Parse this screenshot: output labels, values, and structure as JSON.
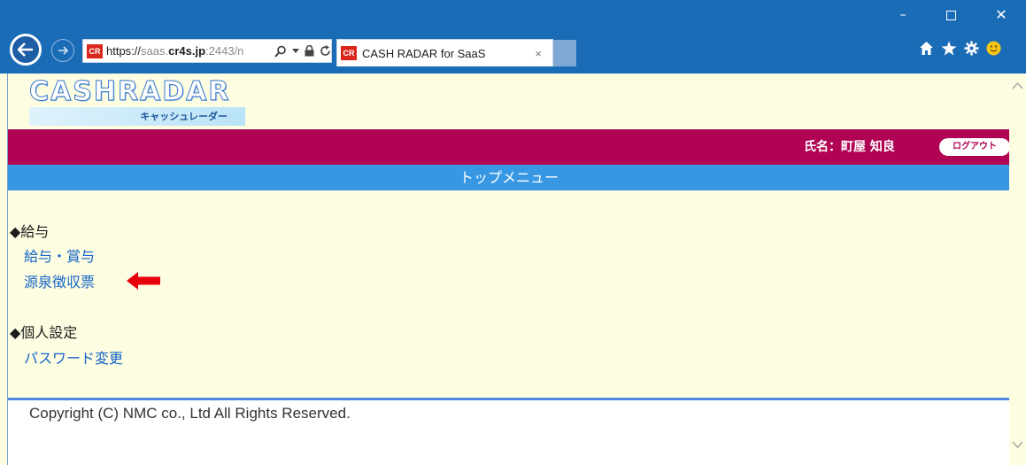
{
  "browser": {
    "url_host": "https://",
    "url_domain": "saas.",
    "url_bold": "cr4s.jp",
    "url_rest": ":2443/n",
    "tab_favicon": "CR",
    "tab_title": "CASH RADAR for SaaS",
    "tab_close": "×",
    "window_minimize": "–",
    "window_close": "✕"
  },
  "page": {
    "logo_text": "CASHRADAR",
    "logo_sub": "キャッシュレーダー",
    "user_label": "氏名：町屋 知良",
    "logout_label": "ログアウト",
    "menu_title": "トップメニュー",
    "sections": [
      {
        "heading": "◆給与",
        "links": [
          "給与・賞与",
          "源泉徴収票"
        ]
      },
      {
        "heading": "◆個人設定",
        "links": [
          "パスワード変更"
        ]
      }
    ],
    "copyright": "Copyright (C) NMC co., Ltd All Rights Reserved."
  },
  "colors": {
    "titlebar": "#1b6cb7",
    "page_bg": "#fdfde2",
    "userbar": "#b00353",
    "menubar": "#3797e3",
    "link": "#1565c8",
    "arrow": "#e8000b"
  },
  "icons": [
    "back-arrow-icon",
    "forward-arrow-icon",
    "search-icon",
    "lock-icon",
    "refresh-icon",
    "home-icon",
    "favorites-star-icon",
    "settings-gear-icon",
    "smiley-feedback-icon",
    "red-arrow-icon"
  ]
}
